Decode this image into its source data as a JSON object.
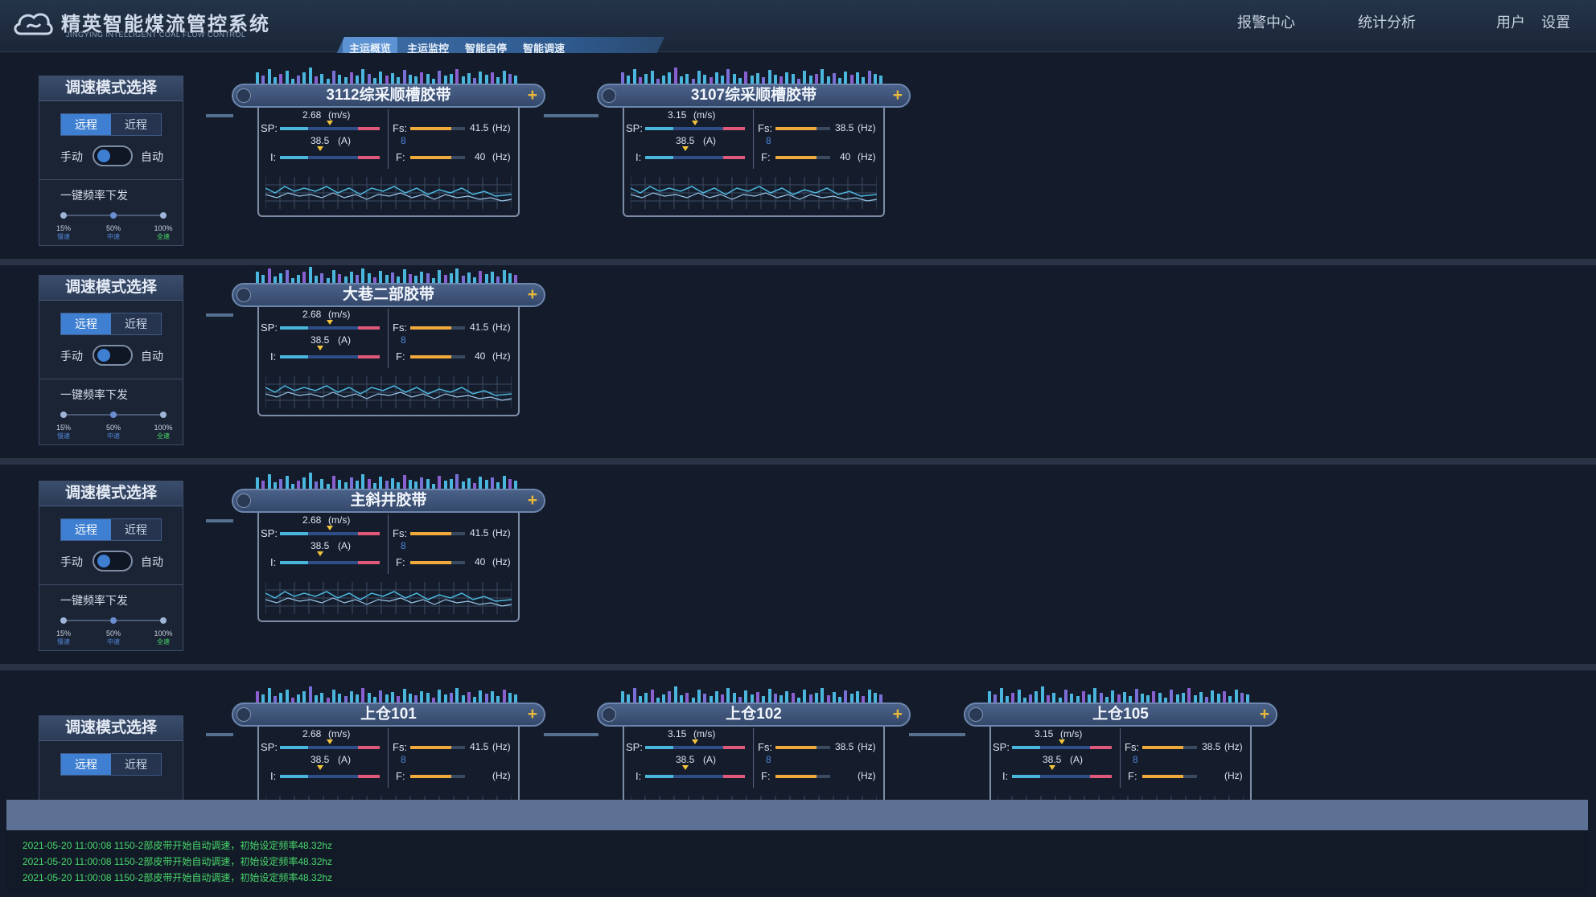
{
  "header": {
    "title": "精英智能煤流管控系统",
    "subtitle": "JINGYING INTELLIGENT COAL FLOW CONTROL",
    "tabs": [
      {
        "label": "主运概览",
        "active": true
      },
      {
        "label": "主运监控",
        "active": false
      },
      {
        "label": "智能启停",
        "active": false
      },
      {
        "label": "智能调速",
        "active": false
      }
    ],
    "links": {
      "alarm": "报警中心",
      "stats": "统计分析",
      "user": "用户",
      "settings": "设置"
    }
  },
  "panel": {
    "title": "调速模式选择",
    "remote": "远程",
    "local": "近程",
    "manual": "手动",
    "auto": "自动",
    "freq_label": "一键频率下发",
    "steps": [
      {
        "pct": "15%",
        "speed": "慢速"
      },
      {
        "pct": "50%",
        "speed": "中速"
      },
      {
        "pct": "100%",
        "speed": "全速"
      }
    ]
  },
  "belts": [
    {
      "name": "3112综采顺槽胶带",
      "speed": "2.68",
      "speed_unit": "(m/s)",
      "current": "38.5",
      "current_unit": "(A)",
      "fs": "41.5",
      "f": "40",
      "hz": "(Hz)"
    },
    {
      "name": "3107综采顺槽胶带",
      "speed": "3.15",
      "speed_unit": "(m/s)",
      "current": "38.5",
      "current_unit": "(A)",
      "fs": "38.5",
      "f": "40",
      "hz": "(Hz)"
    },
    {
      "name": "大巷二部胶带",
      "speed": "2.68",
      "speed_unit": "(m/s)",
      "current": "38.5",
      "current_unit": "(A)",
      "fs": "41.5",
      "f": "40",
      "hz": "(Hz)"
    },
    {
      "name": "主斜井胶带",
      "speed": "2.68",
      "speed_unit": "(m/s)",
      "current": "38.5",
      "current_unit": "(A)",
      "fs": "41.5",
      "f": "40",
      "hz": "(Hz)"
    },
    {
      "name": "上仓101",
      "speed": "2.68",
      "speed_unit": "(m/s)",
      "current": "38.5",
      "current_unit": "(A)",
      "fs": "41.5",
      "f": "",
      "hz": "(Hz)"
    },
    {
      "name": "上仓102",
      "speed": "3.15",
      "speed_unit": "(m/s)",
      "current": "38.5",
      "current_unit": "(A)",
      "fs": "38.5",
      "f": "",
      "hz": "(Hz)"
    },
    {
      "name": "上仓105",
      "speed": "3.15",
      "speed_unit": "(m/s)",
      "current": "38.5",
      "current_unit": "(A)",
      "fs": "38.5",
      "f": "",
      "hz": "(Hz)"
    }
  ],
  "labels": {
    "sp": "SP:",
    "i": "I:",
    "fs": "Fs:",
    "f": "F:",
    "eight": "8"
  },
  "log": [
    "2021-05-20 11:00:08 1150-2部皮带开始自动调速，初始设定频率48.32hz",
    "2021-05-20 11:00:08 1150-2部皮带开始自动调速，初始设定频率48.32hz",
    "2021-05-20 11:00:08 1150-2部皮带开始自动调速，初始设定频率48.32hz"
  ],
  "colors": {
    "accent": "#3e7fd1",
    "speed_bar": "#4bb6dd",
    "alarm_bar": "#e0587a",
    "freq_bar": "#f0a93b",
    "log_text": "#49d86a"
  }
}
